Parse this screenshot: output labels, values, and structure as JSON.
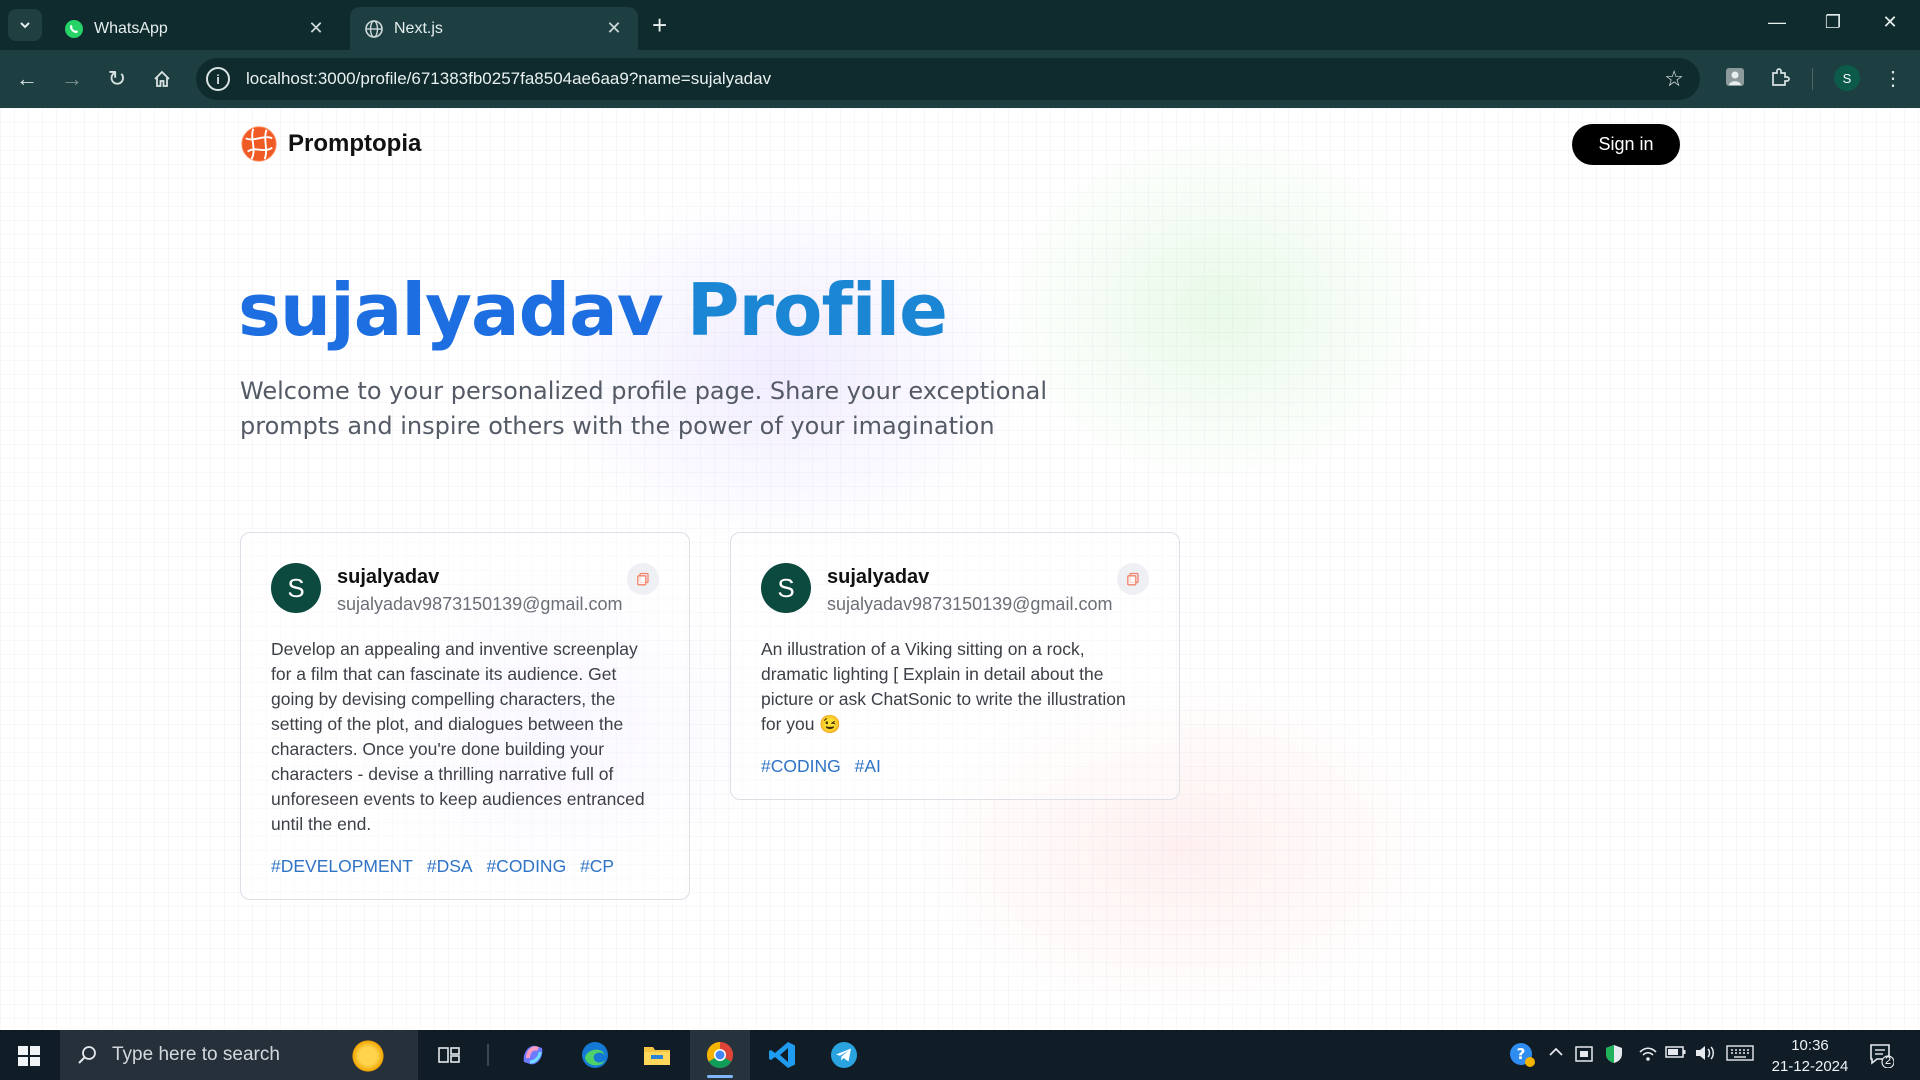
{
  "browser": {
    "tabs": [
      {
        "title": "WhatsApp",
        "active": false
      },
      {
        "title": "Next.js",
        "active": true
      }
    ],
    "url": "localhost:3000/profile/671383fb0257fa8504ae6aa9?name=sujalyadav",
    "profile_initial": "S"
  },
  "nav": {
    "brand": "Promptopia",
    "sign_in": "Sign in"
  },
  "profile": {
    "name": "sujalyadav",
    "title_suffix": "Profile",
    "description": "Welcome to your personalized profile page. Share your exceptional prompts and inspire others with the power of your imagination"
  },
  "cards": [
    {
      "initial": "S",
      "username": "sujalyadav",
      "email": "sujalyadav9873150139@gmail.com",
      "prompt": "Develop an appealing and inventive screenplay for a film that can fascinate its audience. Get going by devising compelling characters, the setting of the plot, and dialogues between the characters. Once you're done building your characters - devise a thrilling narrative full of unforeseen events to keep audiences entranced until the end.",
      "tags": [
        "#DEVELOPMENT",
        "#DSA",
        "#CODING",
        "#CP"
      ]
    },
    {
      "initial": "S",
      "username": "sujalyadav",
      "email": "sujalyadav9873150139@gmail.com",
      "prompt": "An illustration of a Viking sitting on a rock, dramatic lighting [ Explain in detail about the picture or ask ChatSonic to write the illustration for you 😉",
      "tags": [
        "#CODING",
        "#AI"
      ]
    }
  ],
  "taskbar": {
    "search_placeholder": "Type here to search",
    "time": "10:36",
    "date": "21-12-2024",
    "notification_count": "2"
  },
  "colors": {
    "browser_frame": "#0f2b2d",
    "browser_toolbar": "#1e3f41",
    "headline_blue": "#1d6ee0",
    "tag_blue": "#2f73c5",
    "avatar_green": "#0c4a3f",
    "brand_orange": "#f05a24"
  }
}
